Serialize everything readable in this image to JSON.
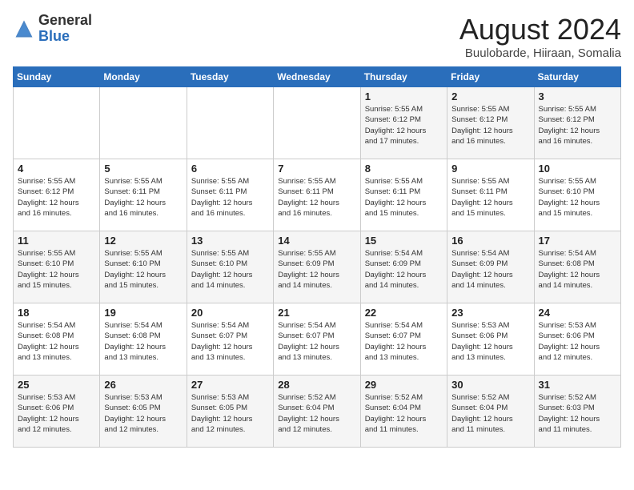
{
  "header": {
    "logo_general": "General",
    "logo_blue": "Blue",
    "month_year": "August 2024",
    "location": "Buulobarde, Hiiraan, Somalia"
  },
  "weekdays": [
    "Sunday",
    "Monday",
    "Tuesday",
    "Wednesday",
    "Thursday",
    "Friday",
    "Saturday"
  ],
  "weeks": [
    [
      {
        "day": "",
        "info": ""
      },
      {
        "day": "",
        "info": ""
      },
      {
        "day": "",
        "info": ""
      },
      {
        "day": "",
        "info": ""
      },
      {
        "day": "1",
        "info": "Sunrise: 5:55 AM\nSunset: 6:12 PM\nDaylight: 12 hours\nand 17 minutes."
      },
      {
        "day": "2",
        "info": "Sunrise: 5:55 AM\nSunset: 6:12 PM\nDaylight: 12 hours\nand 16 minutes."
      },
      {
        "day": "3",
        "info": "Sunrise: 5:55 AM\nSunset: 6:12 PM\nDaylight: 12 hours\nand 16 minutes."
      }
    ],
    [
      {
        "day": "4",
        "info": "Sunrise: 5:55 AM\nSunset: 6:12 PM\nDaylight: 12 hours\nand 16 minutes."
      },
      {
        "day": "5",
        "info": "Sunrise: 5:55 AM\nSunset: 6:11 PM\nDaylight: 12 hours\nand 16 minutes."
      },
      {
        "day": "6",
        "info": "Sunrise: 5:55 AM\nSunset: 6:11 PM\nDaylight: 12 hours\nand 16 minutes."
      },
      {
        "day": "7",
        "info": "Sunrise: 5:55 AM\nSunset: 6:11 PM\nDaylight: 12 hours\nand 16 minutes."
      },
      {
        "day": "8",
        "info": "Sunrise: 5:55 AM\nSunset: 6:11 PM\nDaylight: 12 hours\nand 15 minutes."
      },
      {
        "day": "9",
        "info": "Sunrise: 5:55 AM\nSunset: 6:11 PM\nDaylight: 12 hours\nand 15 minutes."
      },
      {
        "day": "10",
        "info": "Sunrise: 5:55 AM\nSunset: 6:10 PM\nDaylight: 12 hours\nand 15 minutes."
      }
    ],
    [
      {
        "day": "11",
        "info": "Sunrise: 5:55 AM\nSunset: 6:10 PM\nDaylight: 12 hours\nand 15 minutes."
      },
      {
        "day": "12",
        "info": "Sunrise: 5:55 AM\nSunset: 6:10 PM\nDaylight: 12 hours\nand 15 minutes."
      },
      {
        "day": "13",
        "info": "Sunrise: 5:55 AM\nSunset: 6:10 PM\nDaylight: 12 hours\nand 14 minutes."
      },
      {
        "day": "14",
        "info": "Sunrise: 5:55 AM\nSunset: 6:09 PM\nDaylight: 12 hours\nand 14 minutes."
      },
      {
        "day": "15",
        "info": "Sunrise: 5:54 AM\nSunset: 6:09 PM\nDaylight: 12 hours\nand 14 minutes."
      },
      {
        "day": "16",
        "info": "Sunrise: 5:54 AM\nSunset: 6:09 PM\nDaylight: 12 hours\nand 14 minutes."
      },
      {
        "day": "17",
        "info": "Sunrise: 5:54 AM\nSunset: 6:08 PM\nDaylight: 12 hours\nand 14 minutes."
      }
    ],
    [
      {
        "day": "18",
        "info": "Sunrise: 5:54 AM\nSunset: 6:08 PM\nDaylight: 12 hours\nand 13 minutes."
      },
      {
        "day": "19",
        "info": "Sunrise: 5:54 AM\nSunset: 6:08 PM\nDaylight: 12 hours\nand 13 minutes."
      },
      {
        "day": "20",
        "info": "Sunrise: 5:54 AM\nSunset: 6:07 PM\nDaylight: 12 hours\nand 13 minutes."
      },
      {
        "day": "21",
        "info": "Sunrise: 5:54 AM\nSunset: 6:07 PM\nDaylight: 12 hours\nand 13 minutes."
      },
      {
        "day": "22",
        "info": "Sunrise: 5:54 AM\nSunset: 6:07 PM\nDaylight: 12 hours\nand 13 minutes."
      },
      {
        "day": "23",
        "info": "Sunrise: 5:53 AM\nSunset: 6:06 PM\nDaylight: 12 hours\nand 13 minutes."
      },
      {
        "day": "24",
        "info": "Sunrise: 5:53 AM\nSunset: 6:06 PM\nDaylight: 12 hours\nand 12 minutes."
      }
    ],
    [
      {
        "day": "25",
        "info": "Sunrise: 5:53 AM\nSunset: 6:06 PM\nDaylight: 12 hours\nand 12 minutes."
      },
      {
        "day": "26",
        "info": "Sunrise: 5:53 AM\nSunset: 6:05 PM\nDaylight: 12 hours\nand 12 minutes."
      },
      {
        "day": "27",
        "info": "Sunrise: 5:53 AM\nSunset: 6:05 PM\nDaylight: 12 hours\nand 12 minutes."
      },
      {
        "day": "28",
        "info": "Sunrise: 5:52 AM\nSunset: 6:04 PM\nDaylight: 12 hours\nand 12 minutes."
      },
      {
        "day": "29",
        "info": "Sunrise: 5:52 AM\nSunset: 6:04 PM\nDaylight: 12 hours\nand 11 minutes."
      },
      {
        "day": "30",
        "info": "Sunrise: 5:52 AM\nSunset: 6:04 PM\nDaylight: 12 hours\nand 11 minutes."
      },
      {
        "day": "31",
        "info": "Sunrise: 5:52 AM\nSunset: 6:03 PM\nDaylight: 12 hours\nand 11 minutes."
      }
    ]
  ]
}
